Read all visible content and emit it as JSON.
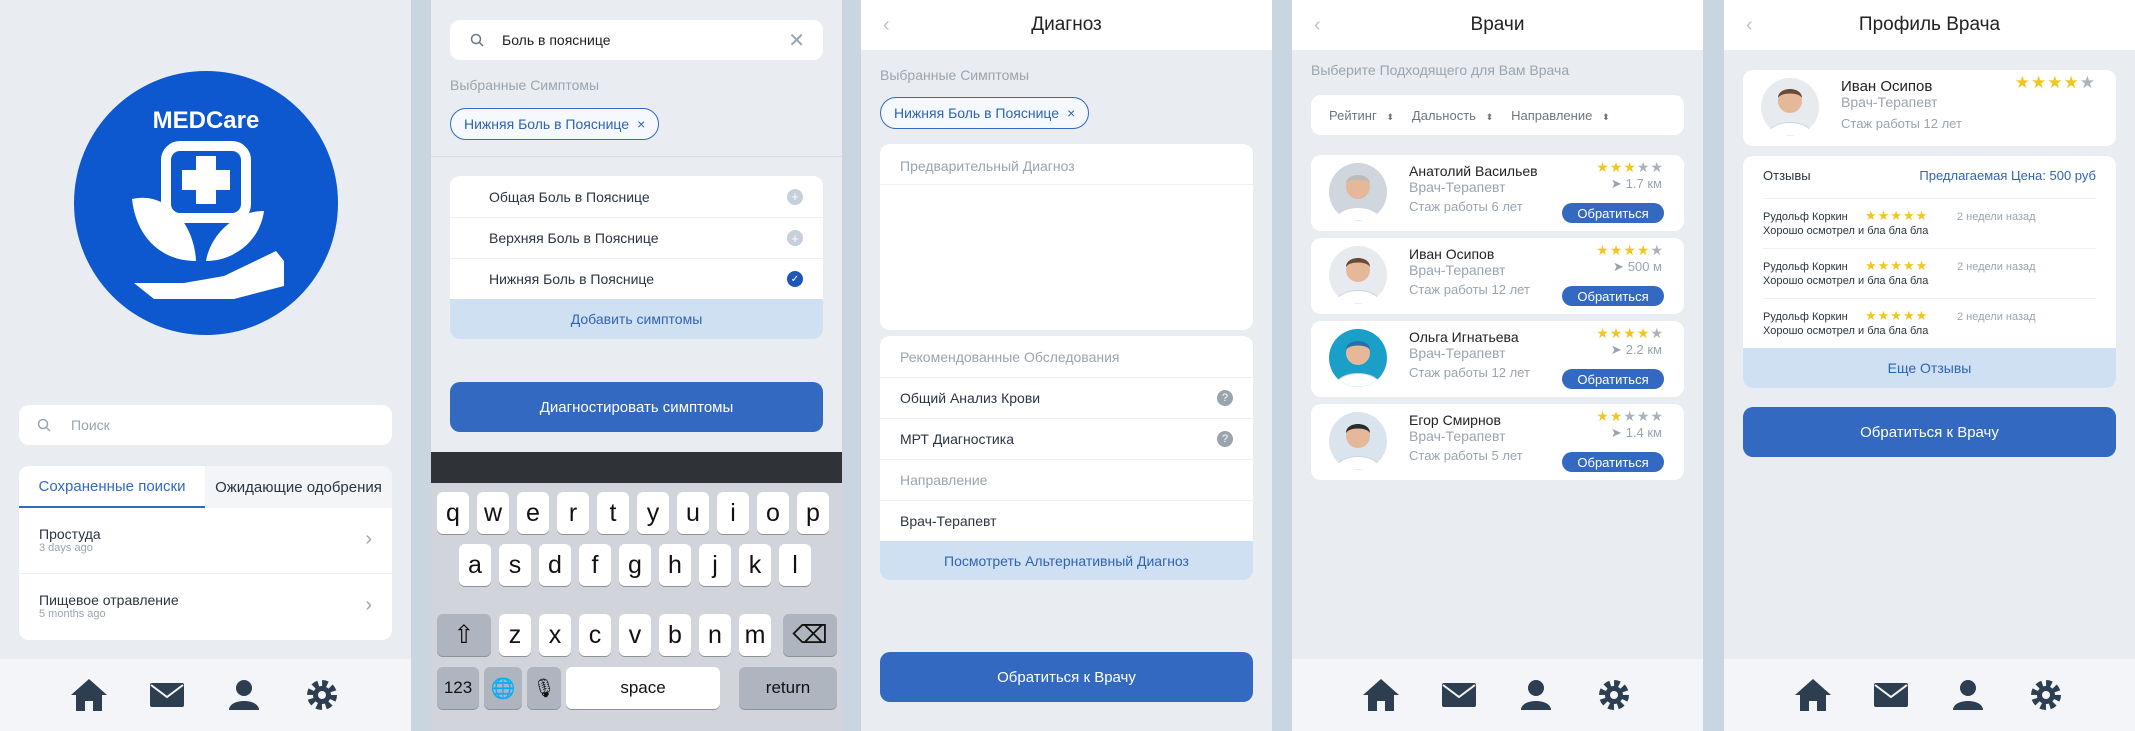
{
  "colors": {
    "brand": "#0d57cf",
    "accent": "#3369c0",
    "bg": "#e9edf2",
    "star": "#f2c61f"
  },
  "s1": {
    "logo_text": "MEDCare",
    "search_placeholder": "Поиск",
    "tabs": [
      "Сохраненные поиски",
      "Ожидающие одобрения"
    ],
    "items": [
      {
        "title": "Простуда",
        "time": "3 days ago"
      },
      {
        "title": "Пищевое отравление",
        "time": "5 months ago"
      }
    ]
  },
  "s2": {
    "search_value": "Боль в пояснице",
    "selected_label": "Выбранные Симптомы",
    "chip": "Нижняя Боль в Пояснице",
    "options": [
      {
        "label": "Общая Боль в Пояснице",
        "checked": false
      },
      {
        "label": "Верхняя Боль в Пояснице",
        "checked": false
      },
      {
        "label": "Нижняя Боль в Пояснице",
        "checked": true
      }
    ],
    "add_label": "Добавить симптомы",
    "diagnose_label": "Диагностировать симптомы",
    "keyboard": {
      "row1": [
        "q",
        "w",
        "e",
        "r",
        "t",
        "y",
        "u",
        "i",
        "o",
        "p"
      ],
      "row2": [
        "a",
        "s",
        "d",
        "f",
        "g",
        "h",
        "j",
        "k",
        "l"
      ],
      "row3": [
        "z",
        "x",
        "c",
        "v",
        "b",
        "n",
        "m"
      ],
      "num": "123",
      "space": "space",
      "return": "return"
    }
  },
  "s3": {
    "title": "Диагноз",
    "selected_label": "Выбранные Симптомы",
    "chip": "Нижняя Боль в Пояснице",
    "prelim_placeholder": "Предварительный Диагноз",
    "recommended_label": "Рекомендованные Обследования",
    "tests": [
      "Общий Анализ Крови",
      "МРТ Диагностика"
    ],
    "direction_label": "Направление",
    "direction_value": "Врач-Терапевт",
    "alt_label": "Посмотреть Альтернативный Диагноз",
    "cta": "Обратиться к Врачу"
  },
  "s4": {
    "title": "Врачи",
    "subtitle": "Выберите Подходящего для Вам Врача",
    "filters": [
      "Рейтинг",
      "Дальность",
      "Направление"
    ],
    "doctors": [
      {
        "name": "Анатолий Васильев",
        "spec": "Врач-Терапевт",
        "exp": "Стаж работы 6 лет",
        "stars": 3,
        "dist": "1.7 км"
      },
      {
        "name": "Иван Осипов",
        "spec": "Врач-Терапевт",
        "exp": "Стаж работы 12 лет",
        "stars": 4,
        "dist": "500 м"
      },
      {
        "name": "Ольга Игнатьева",
        "spec": "Врач-Терапевт",
        "exp": "Стаж работы 12 лет",
        "stars": 4,
        "dist": "2.2 км"
      },
      {
        "name": "Егор Смирнов",
        "spec": "Врач-Терапевт",
        "exp": "Стаж работы 5 лет",
        "stars": 2,
        "dist": "1.4 км"
      }
    ],
    "apply_label": "Обратиться"
  },
  "s5": {
    "title": "Профиль Врача",
    "name": "Иван Осипов",
    "spec": "Врач-Терапевт",
    "exp": "Стаж работы 12 лет",
    "stars": 4,
    "reviews_label": "Отзывы",
    "price": "Предлагаемая Цена: 500 руб",
    "reviews": [
      {
        "author": "Рудольф Коркин",
        "time": "2 недели назад",
        "text": "Хорошо осмотрел и бла бла бла"
      },
      {
        "author": "Рудольф Коркин",
        "time": "2 недели назад",
        "text": "Хорошо осмотрел и бла бла бла"
      },
      {
        "author": "Рудольф Коркин",
        "time": "2 недели назад",
        "text": "Хорошо осмотрел и бла бла бла"
      }
    ],
    "more_label": "Еще Отзывы",
    "cta": "Обратиться к Врачу"
  },
  "tabbar": [
    "home-icon",
    "mail-icon",
    "user-icon",
    "gear-icon"
  ]
}
